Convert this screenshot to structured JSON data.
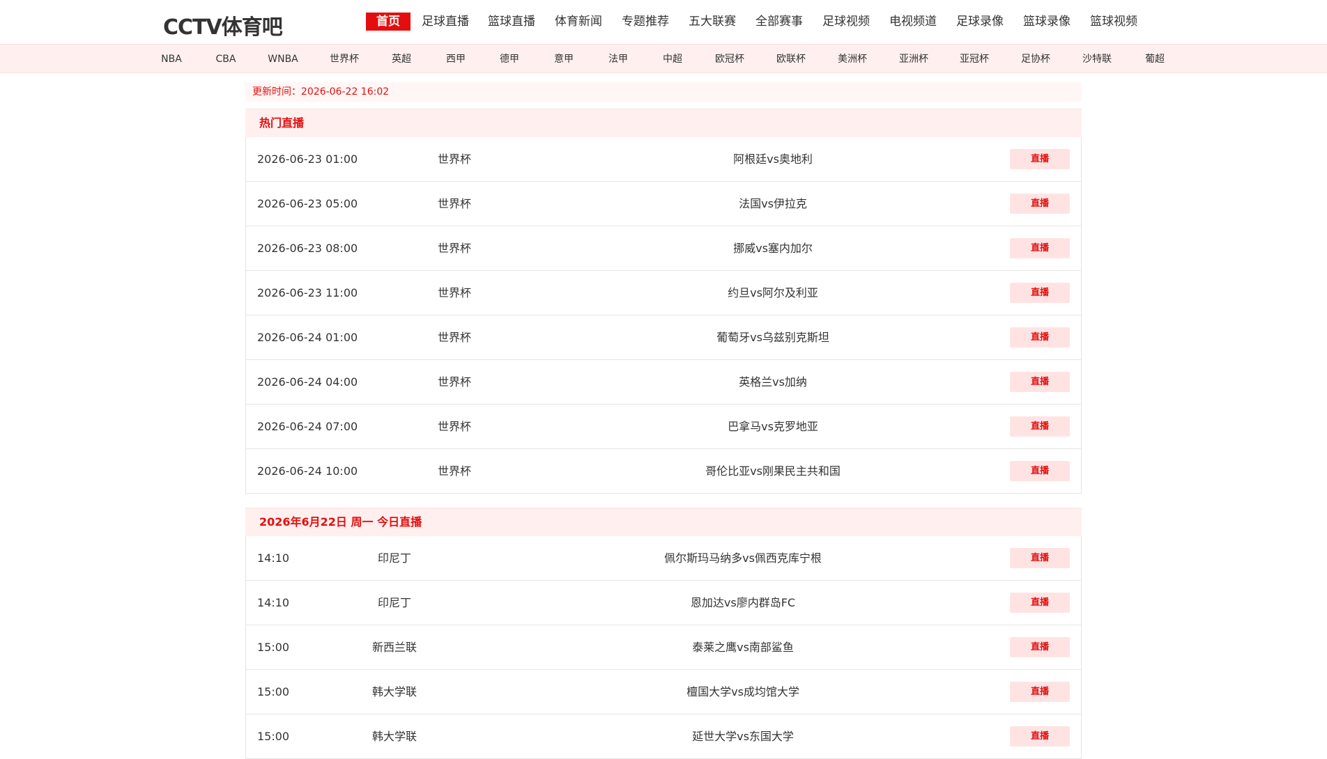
{
  "logo": "CCTV体育吧",
  "main_nav": [
    {
      "label": "首页",
      "active": true
    },
    {
      "label": "足球直播"
    },
    {
      "label": "篮球直播"
    },
    {
      "label": "体育新闻"
    },
    {
      "label": "专题推荐"
    },
    {
      "label": "五大联赛"
    },
    {
      "label": "全部赛事"
    },
    {
      "label": "足球视频"
    },
    {
      "label": "电视频道"
    },
    {
      "label": "足球录像"
    },
    {
      "label": "篮球录像"
    },
    {
      "label": "篮球视频"
    }
  ],
  "sub_nav": [
    "NBA",
    "CBA",
    "WNBA",
    "世界杯",
    "英超",
    "西甲",
    "德甲",
    "意甲",
    "法甲",
    "中超",
    "欧冠杯",
    "欧联杯",
    "美洲杯",
    "亚洲杯",
    "亚冠杯",
    "足协杯",
    "沙特联",
    "葡超"
  ],
  "update_time": "更新时间：2026-06-22 16:02",
  "live_label": "直播",
  "sections": [
    {
      "title": "热门直播",
      "rows": [
        {
          "time": "2026-06-23 01:00",
          "league": "世界杯",
          "match": "阿根廷vs奥地利"
        },
        {
          "time": "2026-06-23 05:00",
          "league": "世界杯",
          "match": "法国vs伊拉克"
        },
        {
          "time": "2026-06-23 08:00",
          "league": "世界杯",
          "match": "挪威vs塞内加尔"
        },
        {
          "time": "2026-06-23 11:00",
          "league": "世界杯",
          "match": "约旦vs阿尔及利亚"
        },
        {
          "time": "2026-06-24 01:00",
          "league": "世界杯",
          "match": "葡萄牙vs乌兹别克斯坦"
        },
        {
          "time": "2026-06-24 04:00",
          "league": "世界杯",
          "match": "英格兰vs加纳"
        },
        {
          "time": "2026-06-24 07:00",
          "league": "世界杯",
          "match": "巴拿马vs克罗地亚"
        },
        {
          "time": "2026-06-24 10:00",
          "league": "世界杯",
          "match": "哥伦比亚vs刚果民主共和国"
        }
      ]
    },
    {
      "title": "2026年6月22日 周一 今日直播",
      "rows": [
        {
          "time": "14:10",
          "league": "印尼丁",
          "match": "佩尔斯玛马纳多vs佩西克库宁根"
        },
        {
          "time": "14:10",
          "league": "印尼丁",
          "match": "恩加达vs廖内群岛FC"
        },
        {
          "time": "15:00",
          "league": "新西兰联",
          "match": "泰莱之鹰vs南部鲨鱼"
        },
        {
          "time": "15:00",
          "league": "韩大学联",
          "match": "檀国大学vs成均馆大学"
        },
        {
          "time": "15:00",
          "league": "韩大学联",
          "match": "延世大学vs东国大学"
        }
      ]
    }
  ],
  "colors": {
    "accent": "#e40e0e",
    "subnav_bg": "#fff0ef",
    "button_bg": "#ffe3e3"
  }
}
